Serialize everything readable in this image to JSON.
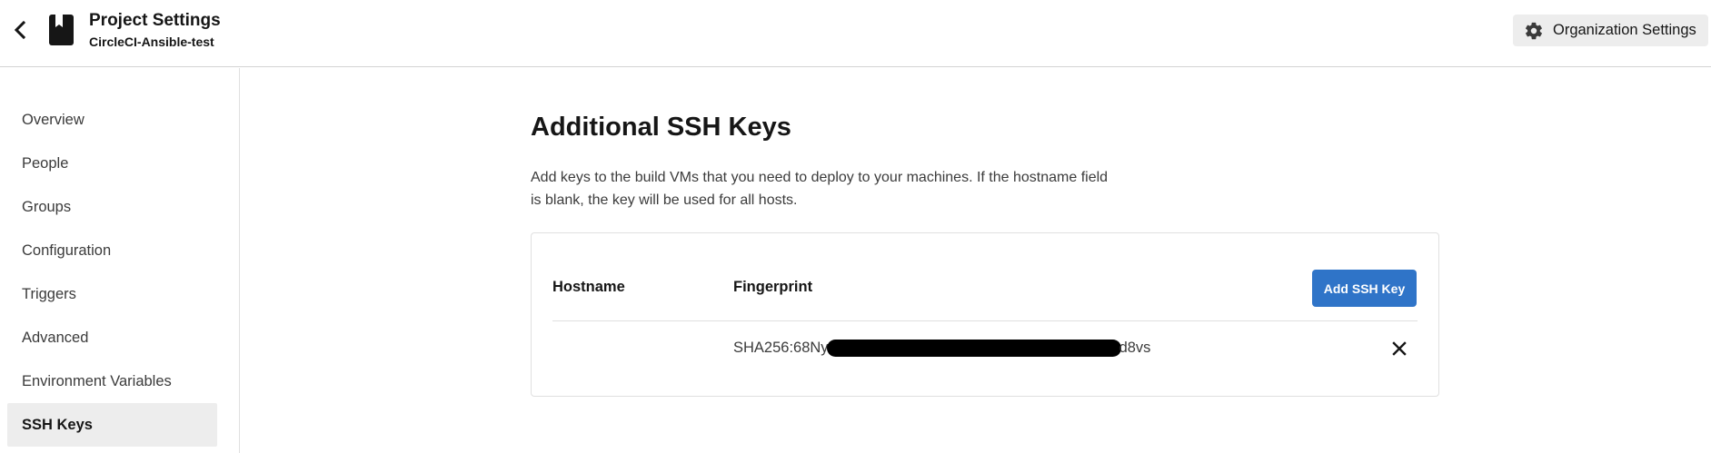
{
  "header": {
    "title": "Project Settings",
    "subtitle": "CircleCI-Ansible-test",
    "back_icon": "chevron-left-icon",
    "project_icon": "bookmark-book-icon",
    "org_settings": {
      "label": "Organization Settings",
      "icon": "gear-icon"
    }
  },
  "sidebar": {
    "items": [
      {
        "label": "Overview",
        "active": false
      },
      {
        "label": "People",
        "active": false
      },
      {
        "label": "Groups",
        "active": false
      },
      {
        "label": "Configuration",
        "active": false
      },
      {
        "label": "Triggers",
        "active": false
      },
      {
        "label": "Advanced",
        "active": false
      },
      {
        "label": "Environment Variables",
        "active": false
      },
      {
        "label": "SSH Keys",
        "active": true
      }
    ]
  },
  "main": {
    "title": "Additional SSH Keys",
    "description": "Add keys to the build VMs that you need to deploy to your machines. If the hostname field is blank, the key will be used for all hosts.",
    "table": {
      "columns": [
        "Hostname",
        "Fingerprint"
      ],
      "add_button": "Add SSH Key",
      "rows": [
        {
          "hostname": "",
          "fingerprint_prefix": "SHA256:68Ny",
          "fingerprint_suffix": "d8vs",
          "delete_icon": "close-icon"
        }
      ]
    }
  },
  "colors": {
    "accent": "#2f74c8",
    "active_nav_bg": "#ededed",
    "org_button_bg": "#ededed",
    "redaction": "#000000"
  }
}
